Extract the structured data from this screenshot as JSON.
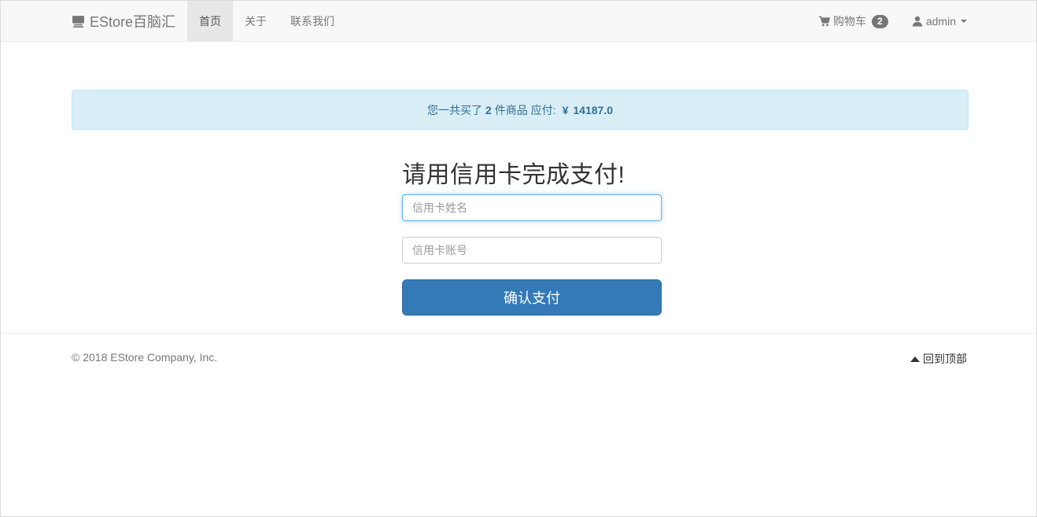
{
  "navbar": {
    "brand_icon": "computer-icon",
    "brand": "EStore百脑汇",
    "links": [
      {
        "label": "首页",
        "active": true
      },
      {
        "label": "关于",
        "active": false
      },
      {
        "label": "联系我们",
        "active": false
      }
    ],
    "cart": {
      "icon": "shopping-cart-icon",
      "label": "购物车",
      "count": "2"
    },
    "user": {
      "icon": "user-icon",
      "label": "admin"
    }
  },
  "alert": {
    "prefix": "您一共买了",
    "count": "2",
    "middle": "件商品 应付:",
    "currency": "¥",
    "amount": "14187.0",
    "color_text": "#31708f",
    "color_bg": "#d9edf7"
  },
  "payment": {
    "title": "请用信用卡完成支付!",
    "name_placeholder": "信用卡姓名",
    "name_value": "",
    "account_placeholder": "信用卡账号",
    "account_value": "",
    "submit_label": "确认支付",
    "accent": "#337ab7"
  },
  "footer": {
    "copyright": "© 2018 EStore Company, Inc.",
    "back_to_top_icon": "triangle-up-icon",
    "back_to_top": "回到顶部"
  }
}
